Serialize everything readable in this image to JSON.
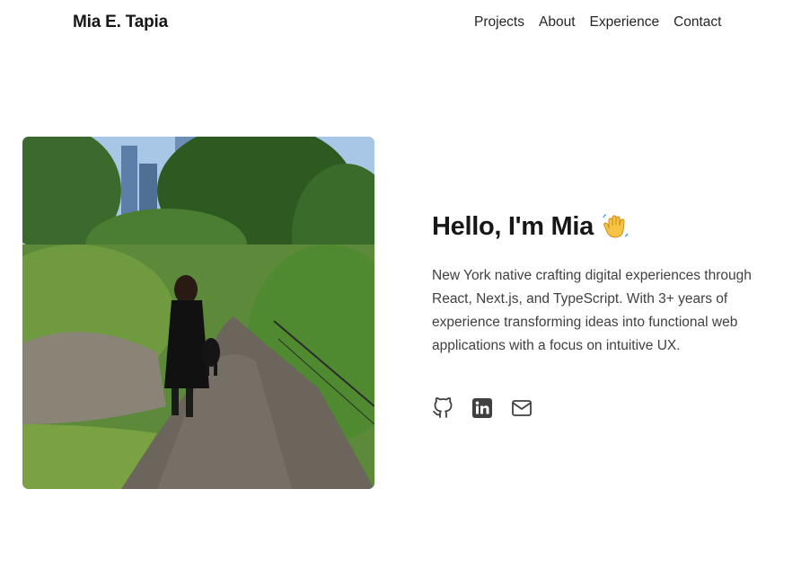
{
  "header": {
    "brand": "Mia E. Tapia",
    "nav": [
      {
        "label": "Projects"
      },
      {
        "label": "About"
      },
      {
        "label": "Experience"
      },
      {
        "label": "Contact"
      }
    ]
  },
  "hero": {
    "greeting": "Hello, I'm Mia",
    "emoji_icon": "waving-hand-icon",
    "intro": "New York native crafting digital experiences through React, Next.js, and TypeScript. With 3+ years of experience transforming ideas into functional web applications with a focus on intuitive UX.",
    "socials": [
      {
        "icon": "github-icon"
      },
      {
        "icon": "linkedin-icon"
      },
      {
        "icon": "mail-icon"
      }
    ]
  },
  "photo": {
    "subject": "woman-walking-dog-park-path"
  }
}
